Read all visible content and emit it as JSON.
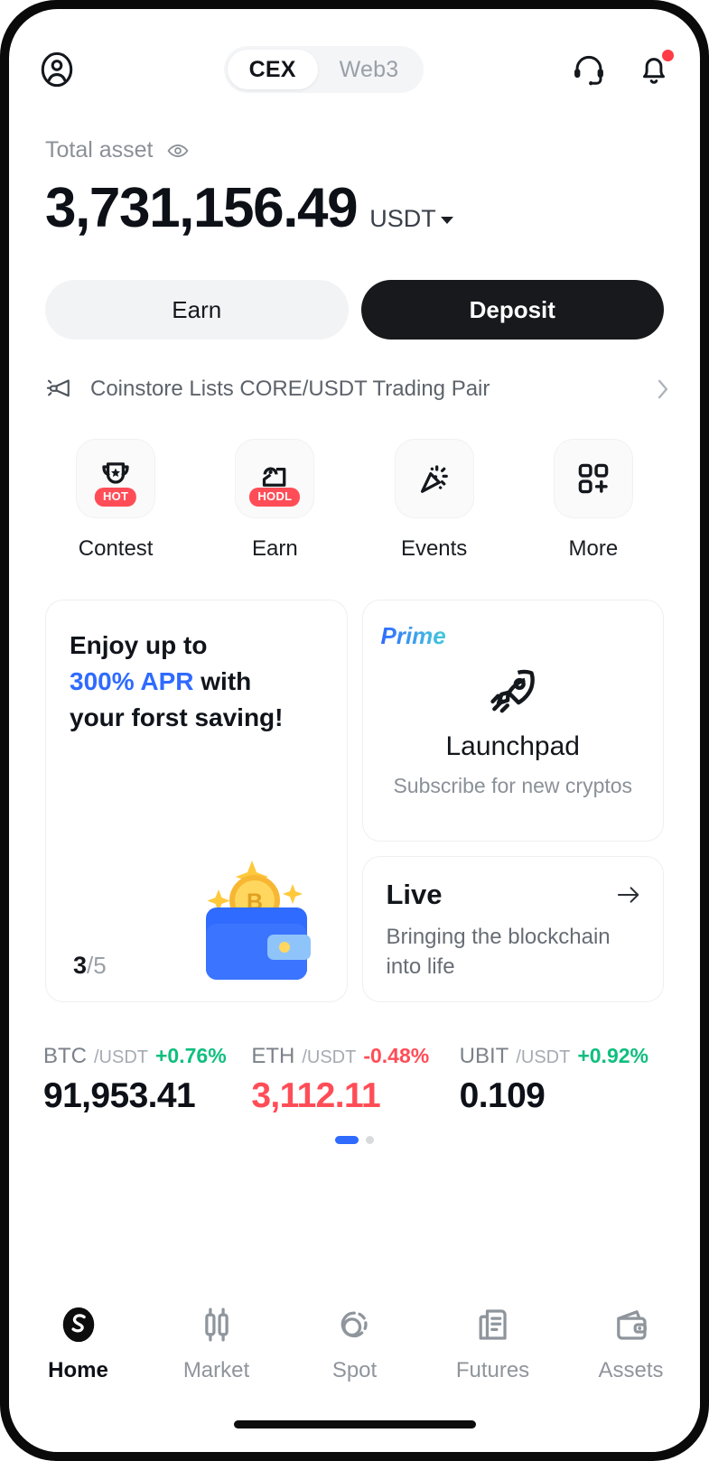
{
  "header": {
    "avatar_icon": "user-circle-icon",
    "tabs": [
      {
        "label": "CEX",
        "active": true
      },
      {
        "label": "Web3",
        "active": false
      }
    ],
    "support_icon": "headset-icon",
    "notification_icon": "bell-icon",
    "notification_badge": true
  },
  "balance": {
    "label": "Total asset",
    "eye_icon": "eye-icon",
    "amount": "3,731,156.49",
    "currency": "USDT",
    "currency_caret": "chevron-down-icon"
  },
  "actions": {
    "earn_label": "Earn",
    "deposit_label": "Deposit"
  },
  "announcement": {
    "icon": "megaphone-icon",
    "text": "Coinstore Lists CORE/USDT Trading Pair",
    "chevron": "chevron-right-icon"
  },
  "quick_actions": [
    {
      "label": "Contest",
      "icon": "trophy-icon",
      "badge": "HOT"
    },
    {
      "label": "Earn",
      "icon": "piggy-hand-icon",
      "badge": "HODL"
    },
    {
      "label": "Events",
      "icon": "confetti-icon",
      "badge": ""
    },
    {
      "label": "More",
      "icon": "grid-plus-icon",
      "badge": ""
    }
  ],
  "promo_card": {
    "line1": "Enjoy up to",
    "accent": "300% APR",
    "line2_tail": " with",
    "line3": "your forst saving!",
    "counter_current": "3",
    "counter_total": "/5",
    "art": "wallet-bitcoin-illustration"
  },
  "launchpad_card": {
    "tag": "Prime",
    "icon": "rocket-icon",
    "title": "Launchpad",
    "subtitle": "Subscribe for new cryptos"
  },
  "live_card": {
    "title": "Live",
    "arrow_icon": "arrow-right-icon",
    "subtitle": "Bringing the blockchain into life"
  },
  "tickers": [
    {
      "base": "BTC",
      "quote": "/USDT",
      "change": "+0.76%",
      "direction": "up",
      "price": "91,953.41"
    },
    {
      "base": "ETH",
      "quote": "/USDT",
      "change": "-0.48%",
      "direction": "down",
      "price": "3,112.11"
    },
    {
      "base": "UBIT",
      "quote": "/USDT",
      "change": "+0.92%",
      "direction": "up",
      "price": "0.109"
    }
  ],
  "pagination": {
    "total": 2,
    "active_index": 0
  },
  "bottom_nav": [
    {
      "label": "Home",
      "icon": "home-logo-icon",
      "active": true
    },
    {
      "label": "Market",
      "icon": "candlestick-icon",
      "active": false
    },
    {
      "label": "Spot",
      "icon": "spot-circles-icon",
      "active": false
    },
    {
      "label": "Futures",
      "icon": "document-icon",
      "active": false
    },
    {
      "label": "Assets",
      "icon": "wallet-icon",
      "active": false
    }
  ],
  "colors": {
    "accent_blue": "#2f6bff",
    "up_green": "#0fbf7e",
    "down_red": "#ff4d57",
    "badge_red": "#ff4d57",
    "primary_dark": "#17191c"
  }
}
